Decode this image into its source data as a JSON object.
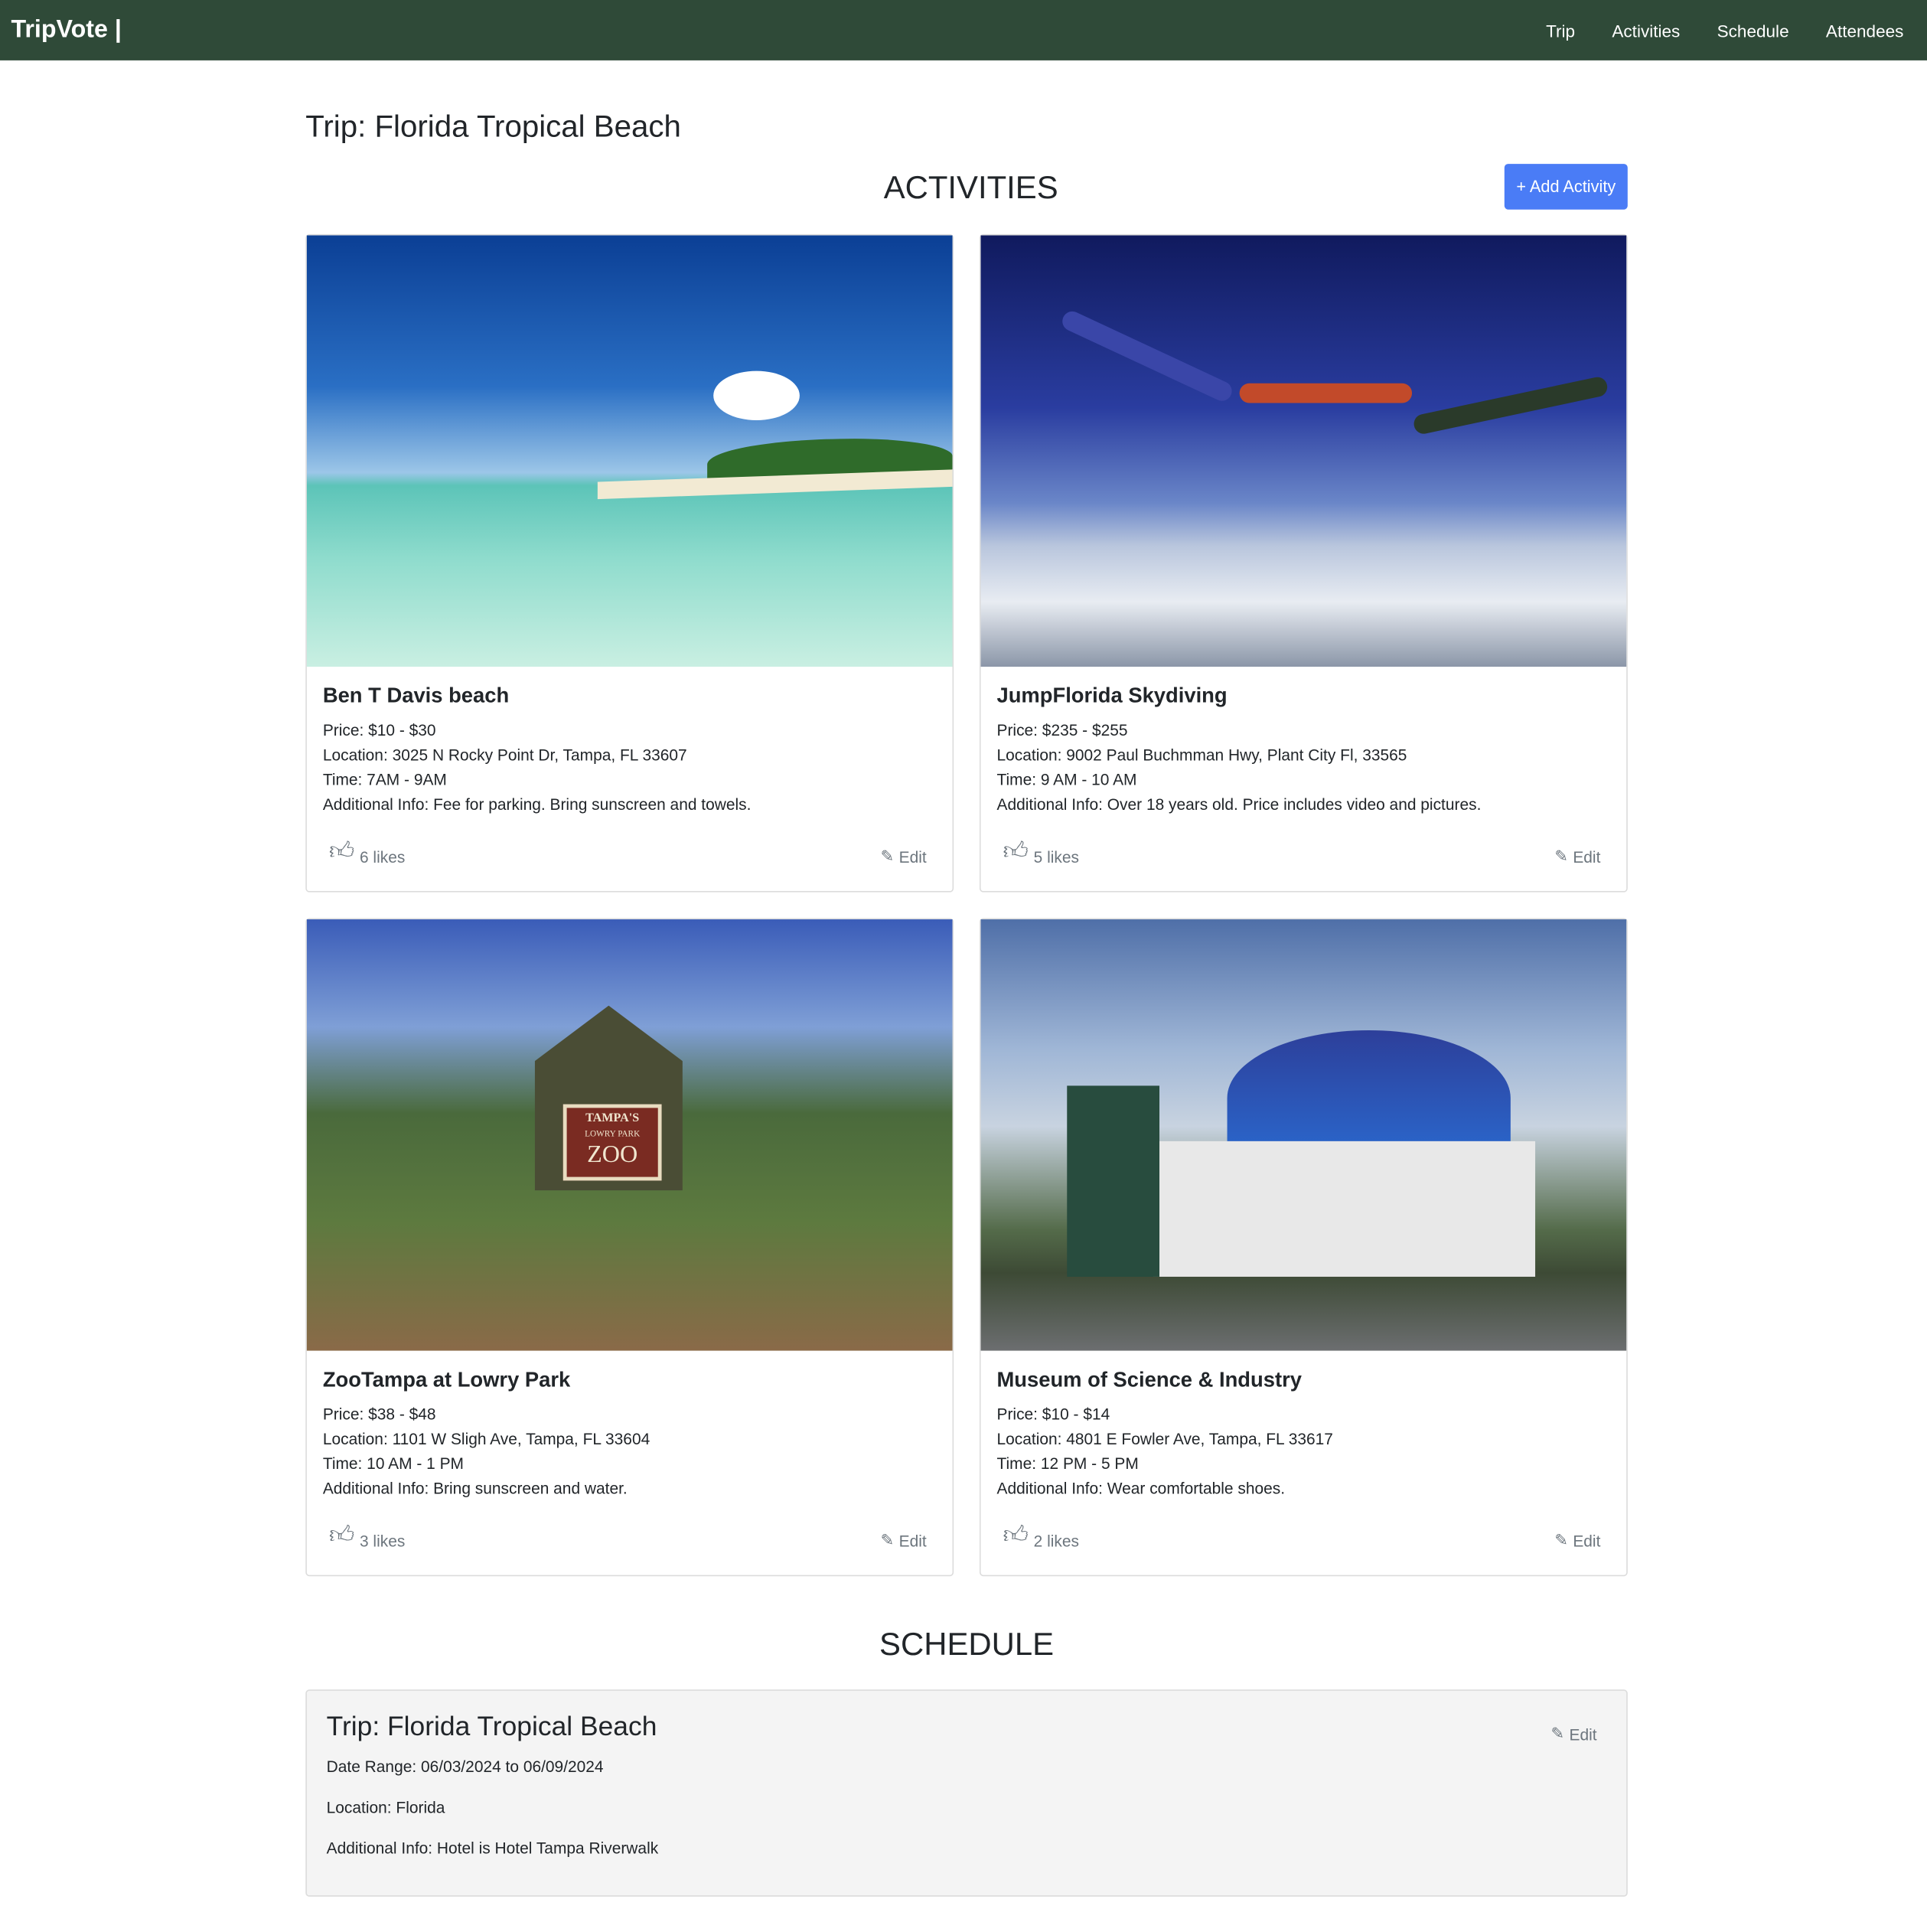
{
  "nav": {
    "brand": "TripVote |",
    "links": [
      "Trip",
      "Activities",
      "Schedule",
      "Attendees"
    ]
  },
  "trip_title": "Trip: Florida Tropical Beach",
  "activities_heading": "ACTIVITIES",
  "add_activity_label": "+ Add Activity",
  "edit_label": "Edit",
  "activities": [
    {
      "title": "Ben T Davis beach",
      "price": "Price: $10 - $30",
      "location": "Location: 3025 N Rocky Point Dr, Tampa, FL 33607",
      "time": "Time: 7AM - 9AM",
      "info": "Additional Info: Fee for parking. Bring sunscreen and towels.",
      "likes": "6 likes"
    },
    {
      "title": "JumpFlorida Skydiving",
      "price": "Price: $235 - $255",
      "location": "Location: 9002 Paul Buchmman Hwy, Plant City Fl, 33565",
      "time": "Time: 9 AM - 10 AM",
      "info": "Additional Info: Over 18 years old. Price includes video and pictures.",
      "likes": "5 likes"
    },
    {
      "title": "ZooTampa at Lowry Park",
      "price": "Price: $38 - $48",
      "location": "Location: 1101 W Sligh Ave, Tampa, FL 33604",
      "time": "Time: 10 AM - 1 PM",
      "info": "Additional Info: Bring sunscreen and water.",
      "likes": "3 likes"
    },
    {
      "title": "Museum of Science & Industry",
      "price": "Price: $10 - $14",
      "location": "Location: 4801 E Fowler Ave, Tampa, FL 33617",
      "time": "Time: 12 PM - 5 PM",
      "info": "Additional Info: Wear comfortable shoes.",
      "likes": "2 likes"
    }
  ],
  "zoo_sign": {
    "line1": "TAMPA'S",
    "line2": "LOWRY PARK",
    "line3": "ZOO"
  },
  "schedule_heading": "SCHEDULE",
  "schedule": {
    "title": "Trip: Florida Tropical Beach",
    "date_range": "Date Range: 06/03/2024 to 06/09/2024",
    "location": "Location: Florida",
    "info": "Additional Info: Hotel is Hotel Tampa Riverwalk"
  }
}
